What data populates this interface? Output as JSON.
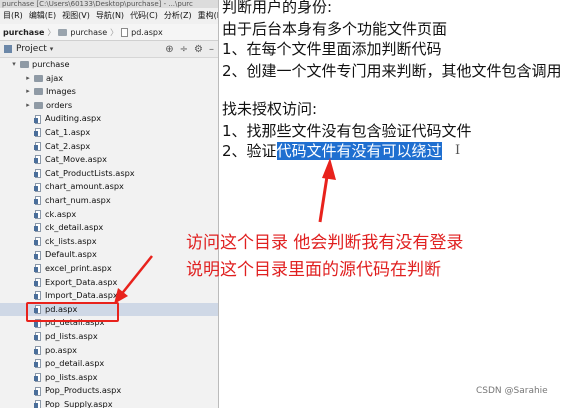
{
  "titlebar": {
    "text": "purchase [C:\\Users\\60133\\Desktop\\purchase] - ...\\purc"
  },
  "menu": [
    "目(R)",
    "编辑(E)",
    "视图(V)",
    "导航(N)",
    "代码(C)",
    "分析(Z)",
    "重构(R"
  ],
  "breadcrumbs": [
    "purchase",
    "purchase",
    "pd.aspx"
  ],
  "project_panel": {
    "label": "Project"
  },
  "tree": [
    {
      "label": "purchase",
      "kind": "folder",
      "indent": 0,
      "arrow": "▾"
    },
    {
      "label": "ajax",
      "kind": "folder",
      "indent": 1,
      "arrow": "▸"
    },
    {
      "label": "Images",
      "kind": "folder",
      "indent": 1,
      "arrow": "▸"
    },
    {
      "label": "orders",
      "kind": "folder",
      "indent": 1,
      "arrow": "▸"
    },
    {
      "label": "Auditing.aspx",
      "kind": "file",
      "indent": 1
    },
    {
      "label": "Cat_1.aspx",
      "kind": "file",
      "indent": 1
    },
    {
      "label": "Cat_2.aspx",
      "kind": "file",
      "indent": 1
    },
    {
      "label": "Cat_Move.aspx",
      "kind": "file",
      "indent": 1
    },
    {
      "label": "Cat_ProductLists.aspx",
      "kind": "file",
      "indent": 1
    },
    {
      "label": "chart_amount.aspx",
      "kind": "file",
      "indent": 1
    },
    {
      "label": "chart_num.aspx",
      "kind": "file",
      "indent": 1
    },
    {
      "label": "ck.aspx",
      "kind": "file",
      "indent": 1
    },
    {
      "label": "ck_detail.aspx",
      "kind": "file",
      "indent": 1
    },
    {
      "label": "ck_lists.aspx",
      "kind": "file",
      "indent": 1
    },
    {
      "label": "Default.aspx",
      "kind": "file",
      "indent": 1
    },
    {
      "label": "excel_print.aspx",
      "kind": "file",
      "indent": 1
    },
    {
      "label": "Export_Data.aspx",
      "kind": "file",
      "indent": 1
    },
    {
      "label": "Import_Data.aspx",
      "kind": "file",
      "indent": 1
    },
    {
      "label": "pd.aspx",
      "kind": "file",
      "indent": 1,
      "selected": true
    },
    {
      "label": "pd_detail.aspx",
      "kind": "file",
      "indent": 1
    },
    {
      "label": "pd_lists.aspx",
      "kind": "file",
      "indent": 1
    },
    {
      "label": "po.aspx",
      "kind": "file",
      "indent": 1
    },
    {
      "label": "po_detail.aspx",
      "kind": "file",
      "indent": 1
    },
    {
      "label": "po_lists.aspx",
      "kind": "file",
      "indent": 1
    },
    {
      "label": "Pop_Products.aspx",
      "kind": "file",
      "indent": 1
    },
    {
      "label": "Pop_Supply.aspx",
      "kind": "file",
      "indent": 1
    }
  ],
  "notes": {
    "l1": "判断用户的身份:",
    "l2": "由于后台本身有多个功能文件页面",
    "l3": "1、在每个文件里面添加判断代码",
    "l4": "2、创建一个文件专门用来判断，其他文件包含调用",
    "l5": "找未授权访问:",
    "l6": "1、找那些文件没有包含验证代码文件",
    "l7_plain": "2、验证",
    "l7_selected": "代码文件有没有可以绕过"
  },
  "annotation": {
    "line1": "访问这个目录 他会判断我有没有登录",
    "line2": "说明这个目录里面的源代码在判断",
    "color": "#e02020"
  },
  "watermark": "CSDN @Sarahie",
  "colors": {
    "selection": "#1f6fd0",
    "tree_highlight": "#cfd8e6",
    "annotation": "#e02020"
  }
}
